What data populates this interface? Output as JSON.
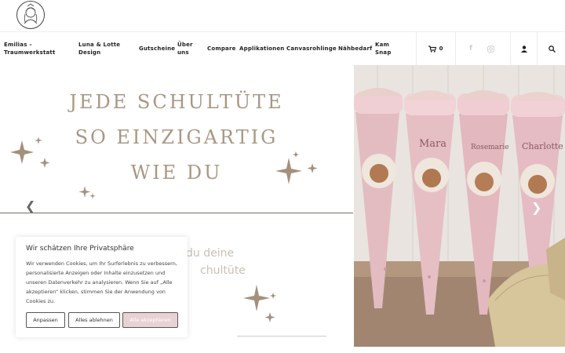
{
  "nav": {
    "items": [
      {
        "label": "Emilias – Traumwerkstatt"
      },
      {
        "label": "Luna & Lotte Design"
      },
      {
        "label": "Gutscheine"
      },
      {
        "label": "Über uns"
      },
      {
        "label": "Compare"
      },
      {
        "label": "Applikationen"
      },
      {
        "label": "Canvasrohlinge"
      },
      {
        "label": "Nähbedarf"
      },
      {
        "label": "Kam Snap"
      }
    ],
    "cart_count": "0",
    "icons": [
      "cart-icon",
      "facebook-icon",
      "instagram-icon",
      "user-icon",
      "search-icon"
    ]
  },
  "hero": {
    "lines": [
      "JEDE SCHULTÜTE",
      "SO EINZIGARTIG",
      "WIE DU"
    ],
    "cone_names": [
      "Mara",
      "Rosemarie",
      "Charlotte"
    ],
    "subtext_line1": "du deine",
    "subtext_line2": "chultüte"
  },
  "cookie": {
    "title": "Wir schätzen Ihre Privatsphäre",
    "text": "Wir verwenden Cookies, um Ihr Surferlebnis zu verbessern, personalisierte Anzeigen oder Inhalte einzusetzen und unseren Datenverkehr zu analysieren. Wenn Sie auf „Alle akzeptieren“ klicken, stimmen Sie der Anwendung von Cookies zu.",
    "buttons": {
      "customize": "Anpassen",
      "reject": "Alles ablehnen",
      "accept": "Alle akzeptieren"
    }
  },
  "colors": {
    "accent_pink": "#e8d2d6",
    "hero_text": "#a99784"
  }
}
